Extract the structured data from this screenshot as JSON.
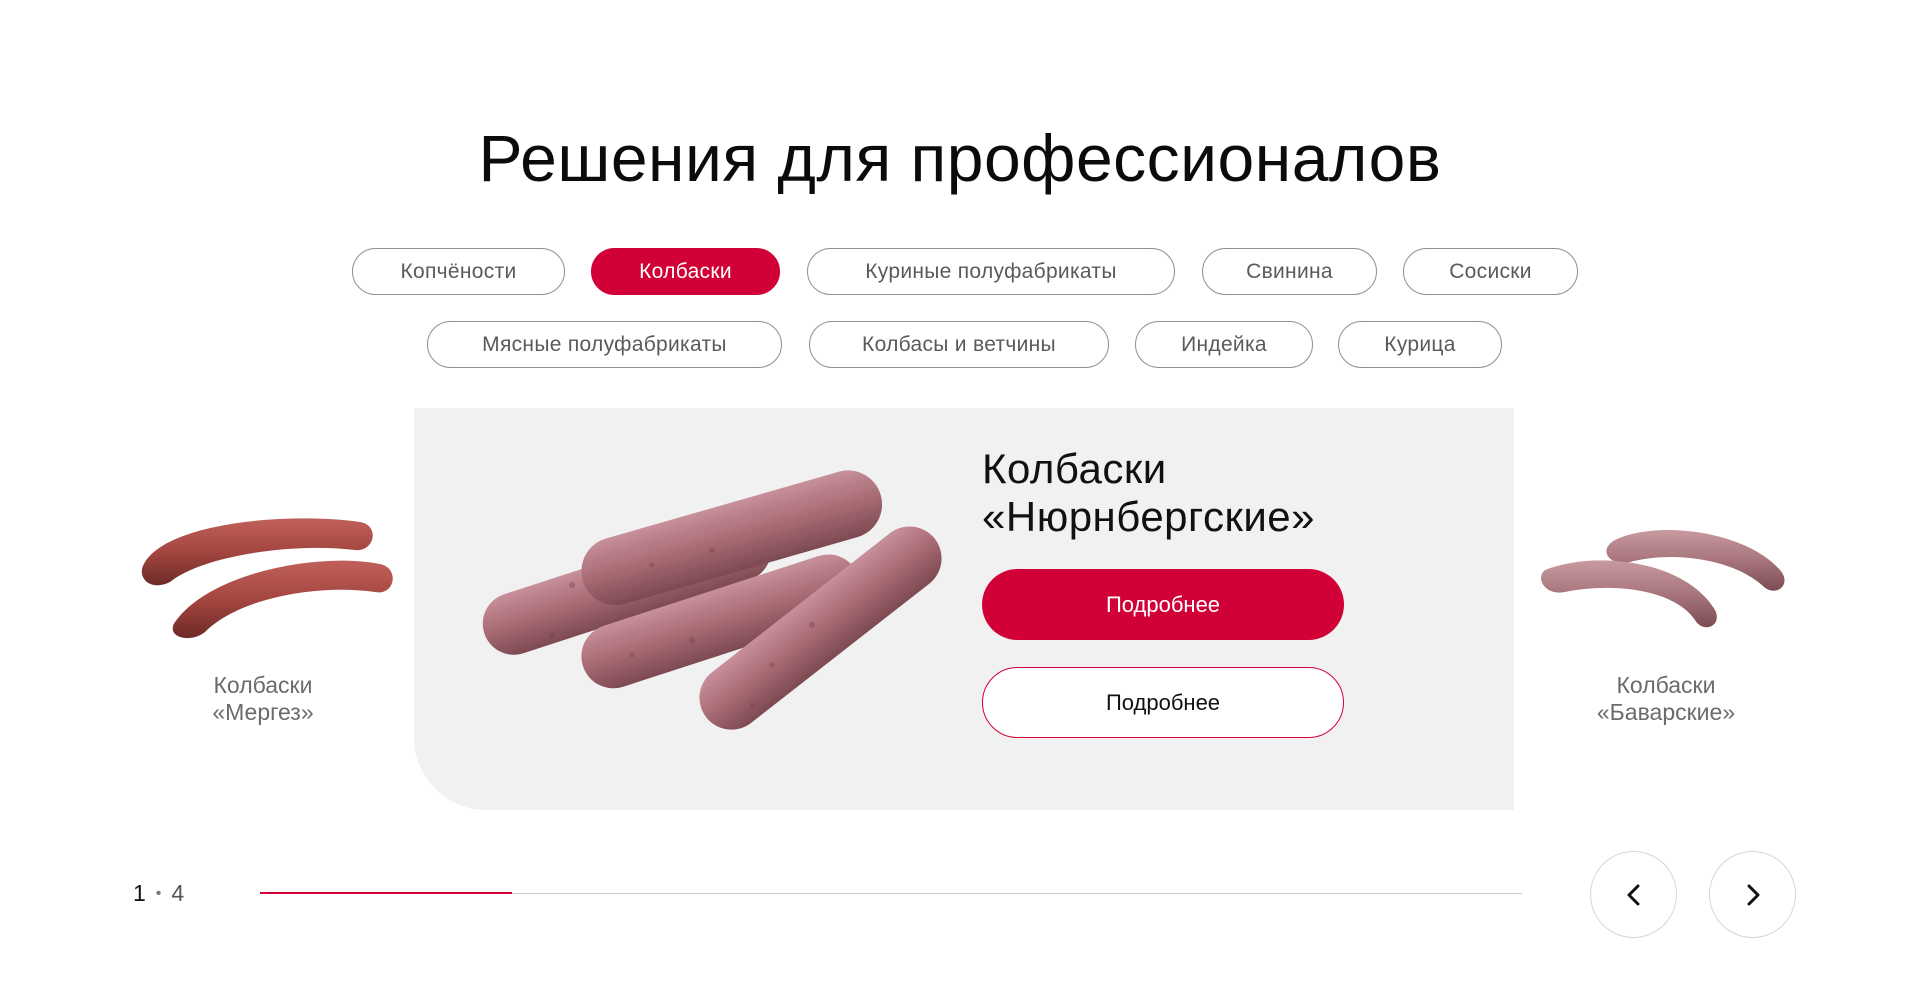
{
  "header": {
    "title": "Решения для профессионалов"
  },
  "categories": {
    "row1": [
      {
        "label": "Копчёности"
      },
      {
        "label": "Колбаски"
      },
      {
        "label": "Куриные полуфабрикаты"
      },
      {
        "label": "Свинина"
      },
      {
        "label": "Сосиски"
      }
    ],
    "row2": [
      {
        "label": "Мясные полуфабрикаты"
      },
      {
        "label": "Колбасы и ветчины"
      },
      {
        "label": "Индейка"
      },
      {
        "label": "Курица"
      }
    ],
    "active": "Колбаски"
  },
  "featured": {
    "title_line1": "Колбаски",
    "title_line2": "«Нюрнбергские»",
    "primary_button": "Подробнее",
    "secondary_button": "Подробнее"
  },
  "prev_product": {
    "line1": "Колбаски",
    "line2": "«Мергез»"
  },
  "next_product": {
    "line1": "Колбаски",
    "line2": "«Баварские»"
  },
  "pagination": {
    "current": "1",
    "separator": "•",
    "total": "4",
    "progress": 0.2
  },
  "colors": {
    "accent": "#d10036",
    "card_bg": "#f1f1f1",
    "chip_border": "#8f8f8f"
  },
  "icons": {
    "prev": "chevron-left-icon",
    "next": "chevron-right-icon"
  }
}
